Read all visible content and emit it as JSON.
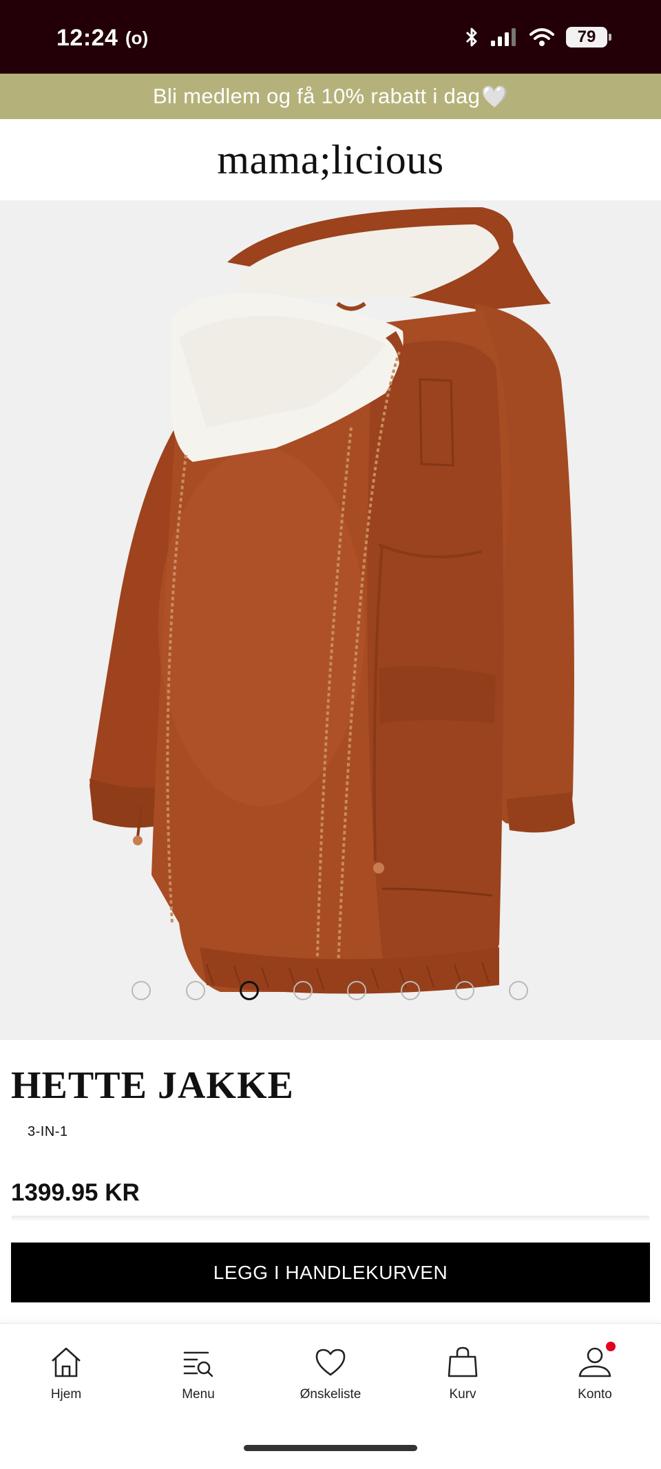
{
  "status_bar": {
    "time": "12:24",
    "radio_indicator": "(o)",
    "battery": "79",
    "icons": [
      "bluetooth-icon",
      "signal-icon",
      "wifi-icon",
      "battery-icon"
    ]
  },
  "promo": {
    "text": "Bli medlem og få 10% rabatt i dag",
    "heart": "🤍"
  },
  "brand": {
    "logo": "mama;licious"
  },
  "gallery": {
    "image_name": "jacket-product-image",
    "total_images": 8,
    "active_index": 2
  },
  "product": {
    "title": "HETTE JAKKE",
    "subtitle": "3-IN-1",
    "price": "1399.95 KR",
    "cta": "LEGG I HANDLEKURVEN"
  },
  "bottom_nav": {
    "items": [
      {
        "label": "Hjem",
        "icon": "home-icon"
      },
      {
        "label": "Menu",
        "icon": "menu-search-icon"
      },
      {
        "label": "Ønskeliste",
        "icon": "heart-icon"
      },
      {
        "label": "Kurv",
        "icon": "bag-icon"
      },
      {
        "label": "Konto",
        "icon": "account-icon",
        "badge": true
      }
    ]
  },
  "colors": {
    "status_bar": "#230008",
    "promo_banner": "#b4b27a",
    "jacket_rust": "#a34a22",
    "sherpa": "#f4f2ec",
    "badge": "#e3001b"
  }
}
